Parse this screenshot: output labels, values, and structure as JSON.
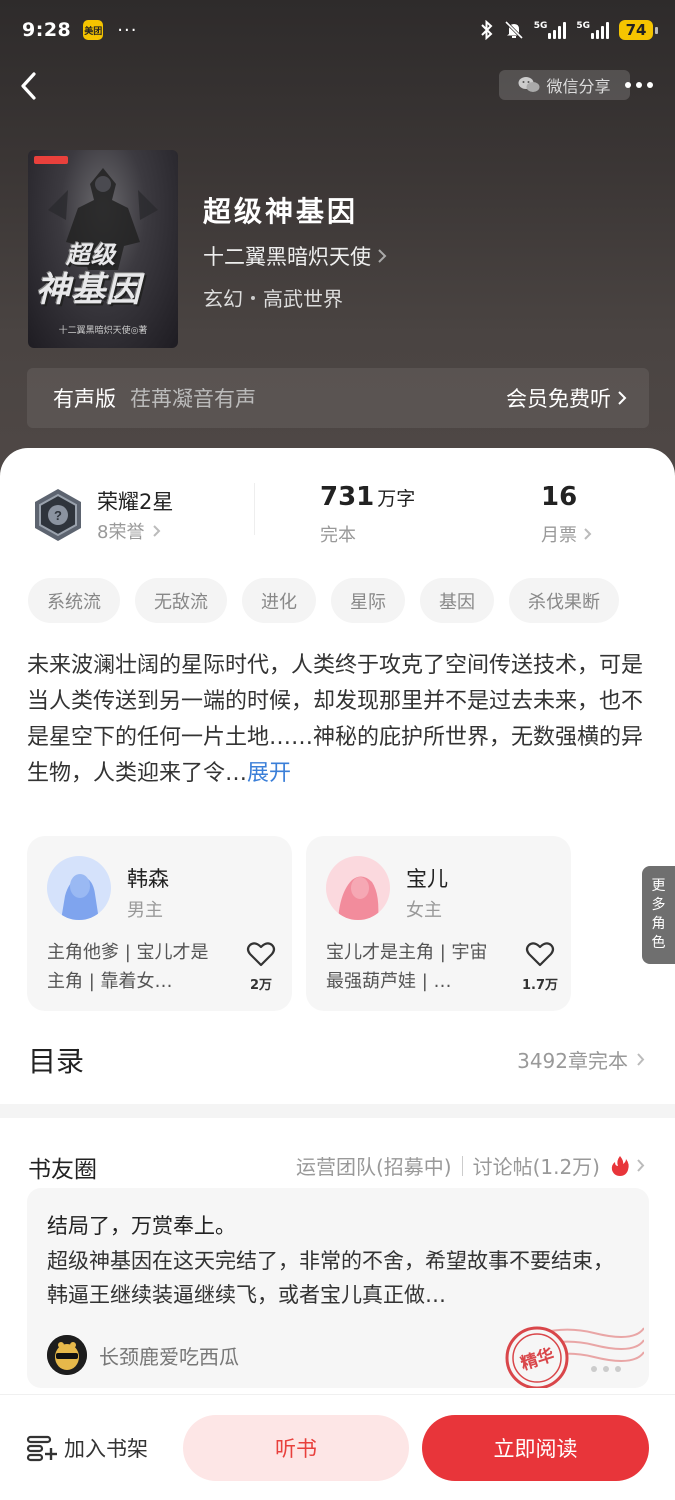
{
  "status_bar": {
    "time": "9:28",
    "app_badge": "美团",
    "more": "···",
    "signal_label_1": "5G",
    "signal_label_2": "5G",
    "battery": "74"
  },
  "top_bar": {
    "share_label": "微信分享"
  },
  "book": {
    "title": "超级神基因",
    "author": "十二翼黑暗炽天使",
    "genre_1": "玄幻",
    "genre_2": "高武世界",
    "cover_title_small": "超级",
    "cover_title_large": "神基因",
    "cover_author": "十二翼黑暗炽天使◎著"
  },
  "audio": {
    "label": "有声版",
    "narrator": "荏苒凝音有声",
    "action": "会员免费听"
  },
  "stats": {
    "honor_title": "荣耀2星",
    "honor_sub": "8荣誉",
    "words_num": "731",
    "words_unit": "万字",
    "words_sub": "完本",
    "ticket_num": "16",
    "ticket_sub": "月票"
  },
  "tags": [
    "系统流",
    "无敌流",
    "进化",
    "星际",
    "基因",
    "杀伐果断"
  ],
  "intro": {
    "text": "未来波澜壮阔的星际时代，人类终于攻克了空间传送技术，可是当人类传送到另一端的时候，却发现那里并不是过去未来，也不是星空下的任何一片土地……神秘的庇护所世界，无数强横的异生物，人类迎来了令…",
    "expand": "展开"
  },
  "roles": [
    {
      "name": "韩森",
      "type": "男主",
      "desc": "主角他爹 | 宝儿才是主角 | 靠着女…",
      "likes": "2万"
    },
    {
      "name": "宝儿",
      "type": "女主",
      "desc": "宝儿才是主角 | 宇宙最强葫芦娃 | …",
      "likes": "1.7万"
    }
  ],
  "more_roles": [
    "更",
    "多",
    "角",
    "色"
  ],
  "toc": {
    "title": "目录",
    "meta": "3492章完本"
  },
  "circle": {
    "title": "书友圈",
    "team": "运营团队(招募中)",
    "posts": "讨论帖(1.2万)"
  },
  "post": {
    "title": "结局了，万赏奉上。",
    "body": "超级神基因在这天完结了，非常的不舍，希望故事不要结束，韩逼王继续装逼继续飞，或者宝儿真正做…",
    "user": "长颈鹿爱吃西瓜",
    "stamp": "精华"
  },
  "bottom_bar": {
    "shelf": "加入书架",
    "listen": "听书",
    "read": "立即阅读"
  },
  "colors": {
    "accent": "#e8353a",
    "link": "#3b7fd8",
    "listen_bg": "#fde6e6"
  }
}
